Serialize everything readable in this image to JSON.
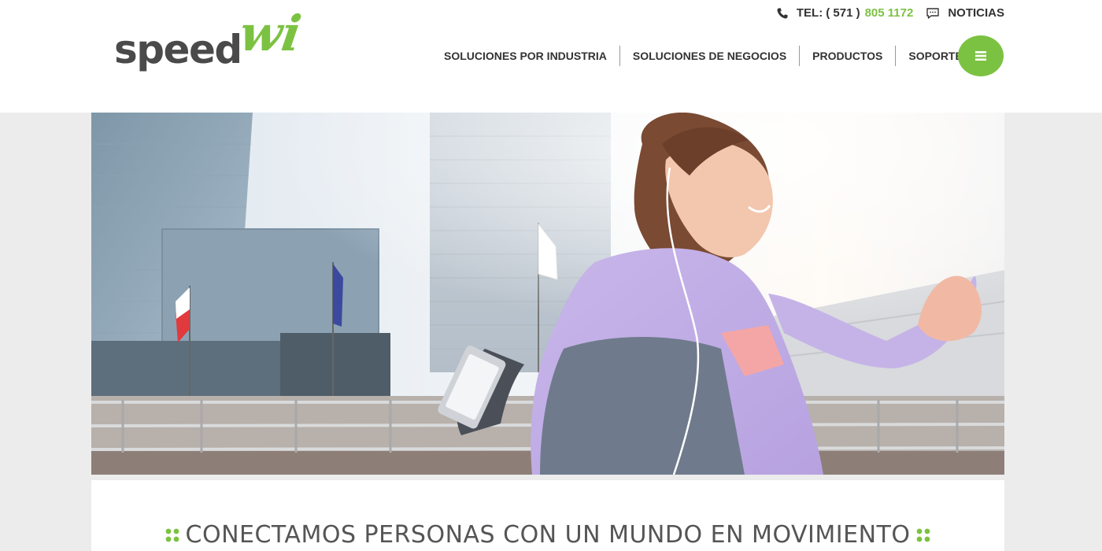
{
  "brand": {
    "logo_main": "speed",
    "logo_accent": "wi"
  },
  "topbar": {
    "tel_label": "TEL:",
    "tel_area": "( 571 )",
    "tel_number": "805 1172",
    "news_label": "NOTICIAS"
  },
  "nav": {
    "items": [
      "SOLUCIONES POR INDUSTRIA",
      "SOLUCIONES DE NEGOCIOS",
      "PRODUCTOS",
      "SOPORTE"
    ]
  },
  "hero": {
    "tagline": "CONECTAMOS PERSONAS CON UN MUNDO EN MOVIMIENTO"
  },
  "colors": {
    "accent": "#7cc242",
    "text_dark": "#333333",
    "logo_gray": "#4a4a4a",
    "page_gray": "#ececec"
  },
  "icons": {
    "phone": "phone-icon",
    "news": "chat-bubble-icon",
    "menu": "hamburger-menu-icon",
    "decoration": "four-dots-icon"
  }
}
